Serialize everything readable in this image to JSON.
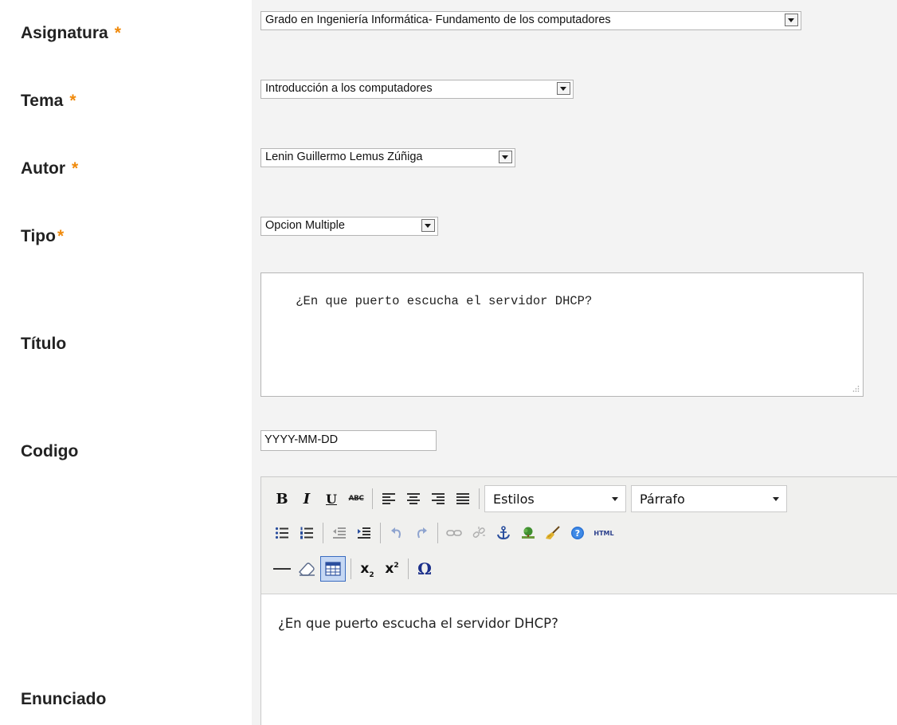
{
  "form": {
    "asignatura": {
      "label": "Asignatura",
      "required": "*",
      "value": "Grado en Ingeniería Informática- Fundamento de los computadores"
    },
    "tema": {
      "label": "Tema",
      "required": "*",
      "value": "Introducción a los computadores"
    },
    "autor": {
      "label": "Autor",
      "required": "*",
      "value": "Lenin Guillermo Lemus Zúñiga"
    },
    "tipo": {
      "label": "Tipo",
      "required": "*",
      "value": "Opcion Multiple"
    },
    "titulo": {
      "label": "Título",
      "value": "¿En que puerto escucha el servidor DHCP?"
    },
    "codigo": {
      "label": "Codigo",
      "value": "YYYY-MM-DD"
    },
    "enunciado": {
      "label": "Enunciado",
      "content": "¿En que puerto escucha el servidor DHCP?",
      "toolbar": {
        "bold": "B",
        "italic": "I",
        "underline": "U",
        "strikethrough": "ABC",
        "styles_value": "Estilos",
        "format_value": "Párrafo",
        "html_button": "HTML",
        "subscript": "x",
        "superscript": "x",
        "special_char": "Ω",
        "active_tool": "table"
      }
    }
  },
  "colors": {
    "required_star": "#f08a0c",
    "field_background": "#f3f3f3",
    "toolbar_background": "#f0f0ee"
  }
}
